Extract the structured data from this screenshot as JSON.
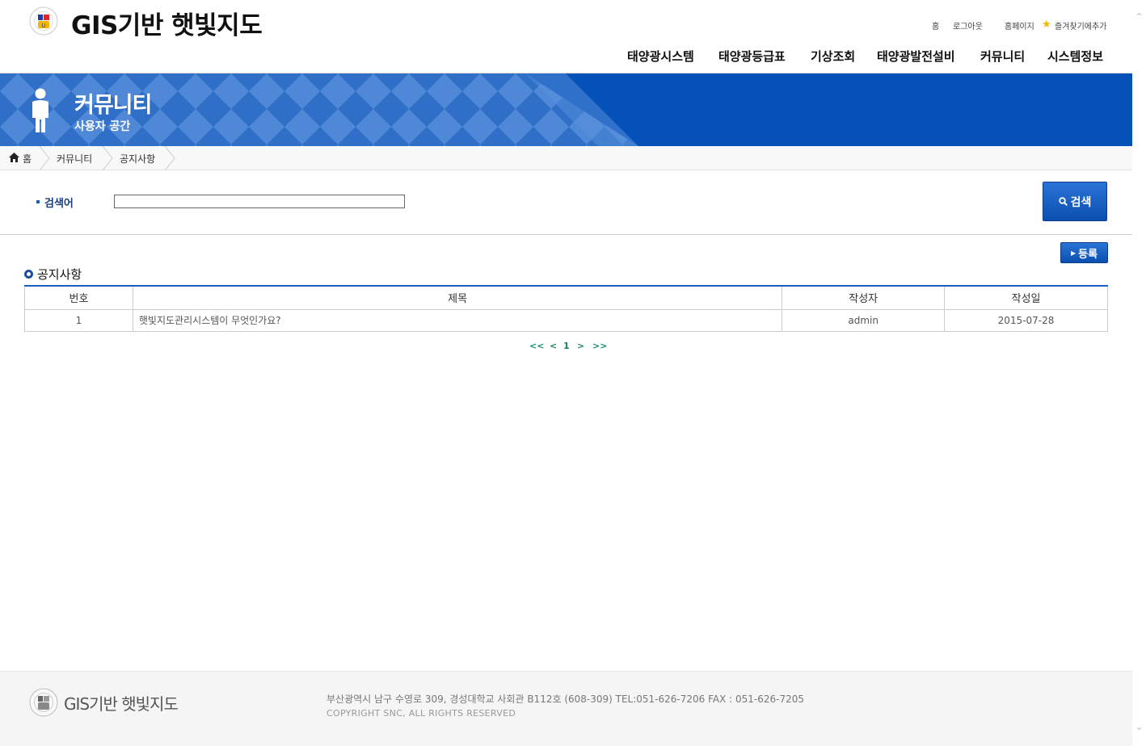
{
  "header": {
    "site_title": "GIS기반 햇빛지도",
    "util_links": [
      {
        "label": "홈"
      },
      {
        "label": "로그아웃"
      },
      {
        "label": "홈페이지"
      },
      {
        "label": "즐겨찾기에추가"
      }
    ],
    "nav": [
      {
        "label": "태양광시스템"
      },
      {
        "label": "태양광등급표"
      },
      {
        "label": "기상조회"
      },
      {
        "label": "태양광발전설비"
      },
      {
        "label": "커뮤니티"
      },
      {
        "label": "시스템정보"
      }
    ]
  },
  "banner": {
    "title": "커뮤니티",
    "subtitle": "사용자 공간",
    "color": "#0451b8"
  },
  "breadcrumb": [
    "홈",
    "커뮤니티",
    "공지사항"
  ],
  "search": {
    "label": "검색어",
    "value": "",
    "button_label": "검색"
  },
  "register_label": "등록",
  "section_title": "공지사항",
  "table": {
    "headers": [
      "번호",
      "제목",
      "작성자",
      "작성일"
    ],
    "rows": [
      {
        "no": "1",
        "title": "햇빛지도관리시스템이 무엇인가요?",
        "author": "admin",
        "date": "2015-07-28"
      }
    ]
  },
  "pagination": {
    "first": "<<",
    "prev": "<",
    "current": "1",
    "next": ">",
    "last": ">>"
  },
  "footer": {
    "title": "GIS기반 햇빛지도",
    "address": "부산광역시 남구 수영로 309, 경성대학교 사회관 B112호 (608-309) TEL:051-626-7206 FAX : 051-626-7205",
    "copyright": "COPYRIGHT SNC, ALL RIGHTS RESERVED"
  },
  "icons": {
    "logo": "university-emblem-icon",
    "star": "star-icon",
    "person": "person-icon",
    "home": "home-icon",
    "search": "search-icon"
  }
}
